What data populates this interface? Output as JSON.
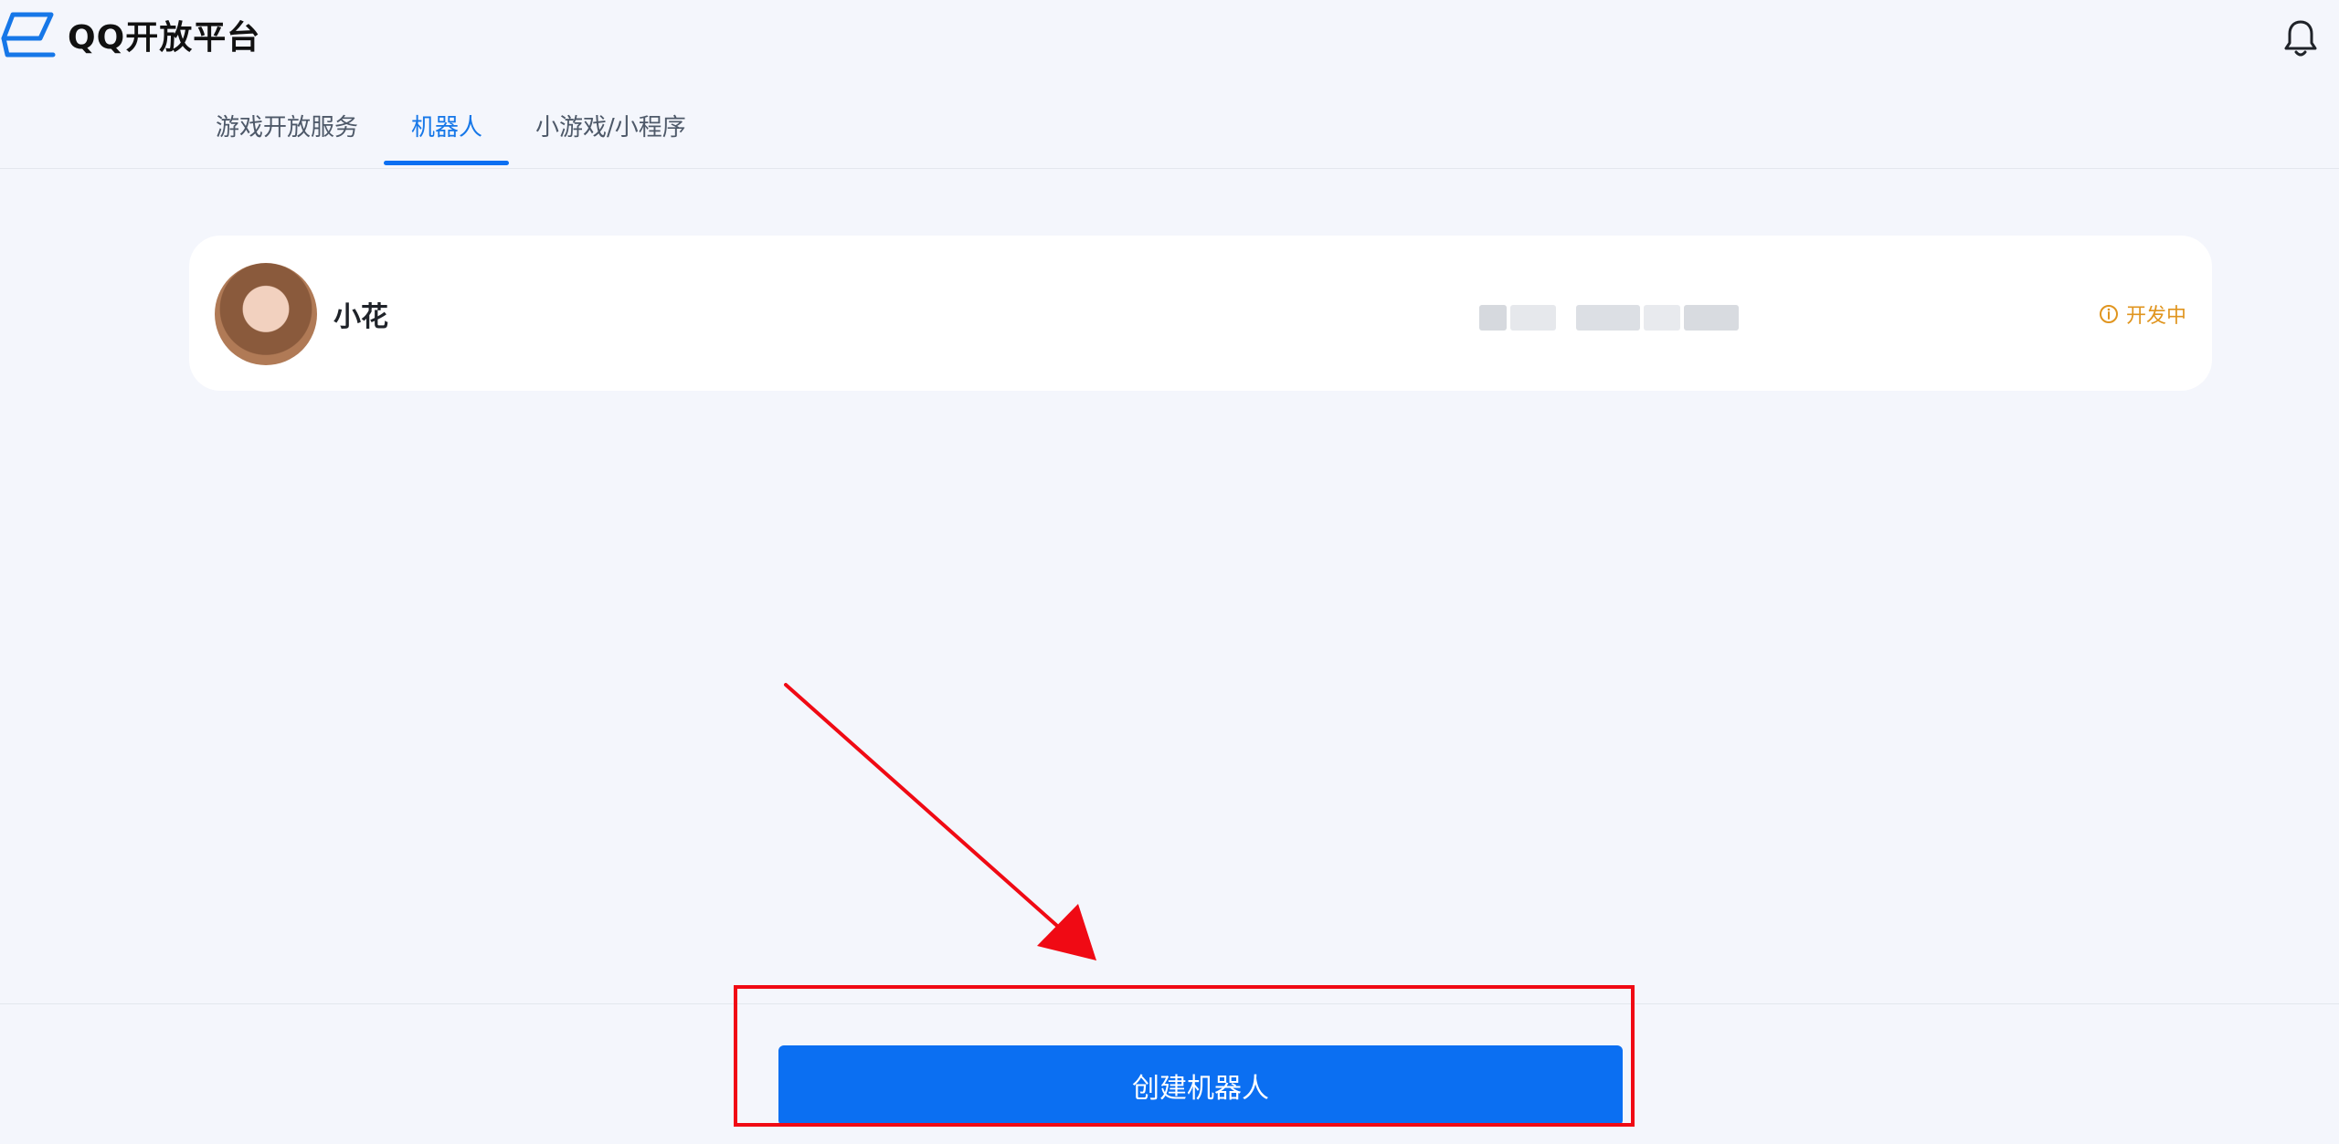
{
  "header": {
    "logo_text": "QQ开放平台",
    "logo_icon": "qq-open-platform-logo",
    "notification_icon": "bell-icon"
  },
  "tabs": [
    {
      "label": "游戏开放服务",
      "active": false
    },
    {
      "label": "机器人",
      "active": true
    },
    {
      "label": "小游戏/小程序",
      "active": false
    }
  ],
  "bot": {
    "name": "小花",
    "id_redacted": true,
    "status": "开发中",
    "status_color": "#e0951f"
  },
  "actions": {
    "create_button_label": "创建机器人"
  },
  "colors": {
    "accent": "#0b6ff2",
    "annotation": "#f00a14",
    "background": "#f4f6fc"
  }
}
